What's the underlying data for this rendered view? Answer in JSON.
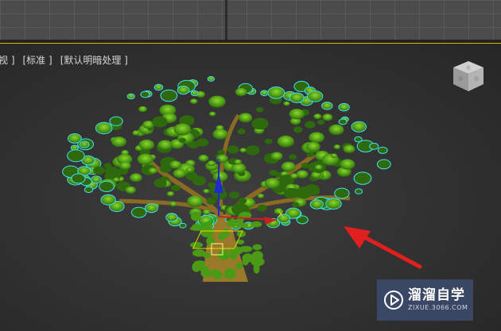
{
  "viewport": {
    "label_view": "视 ]",
    "label_standard": "[标准 ]",
    "label_shading": "[默认明暗处理 ]"
  },
  "watermark": {
    "title": "溜溜自学",
    "url": "ZIXUE.3066.COM"
  },
  "gizmo": {
    "axis_z": "Z",
    "axis_x": "X"
  },
  "colors": {
    "viewport_border": "#d8b800",
    "selection_outline": "#40e0f0",
    "foliage": "#3f8f12",
    "annotation_arrow": "#e0201e",
    "gizmo_z": "#1e2ccc"
  },
  "icons": {
    "viewcube": "viewcube-icon",
    "logo": "play-logo-icon",
    "arrow": "red-annotation-arrow"
  }
}
